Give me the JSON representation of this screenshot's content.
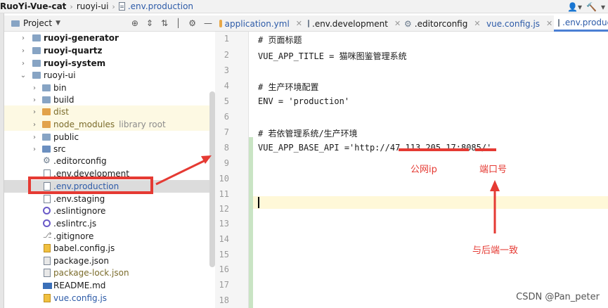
{
  "breadcrumb": {
    "project": "RuoYi-Vue-cat",
    "module": "ruoyi-ui",
    "file": ".env.production"
  },
  "project_panel": {
    "title": "Project"
  },
  "tree": [
    {
      "label": "ruoyi-generator",
      "bold": true
    },
    {
      "label": "ruoyi-quartz",
      "bold": true
    },
    {
      "label": "ruoyi-system",
      "bold": true
    },
    {
      "label": "ruoyi-ui"
    },
    {
      "label": "bin"
    },
    {
      "label": "build"
    },
    {
      "label": "dist"
    },
    {
      "label": "node_modules",
      "suffix": "library root"
    },
    {
      "label": "public"
    },
    {
      "label": "src"
    },
    {
      "label": ".editorconfig"
    },
    {
      "label": ".env.development"
    },
    {
      "label": ".env.production"
    },
    {
      "label": ".env.staging"
    },
    {
      "label": ".eslintignore"
    },
    {
      "label": ".eslintrc.js"
    },
    {
      "label": ".gitignore"
    },
    {
      "label": "babel.config.js"
    },
    {
      "label": "package.json"
    },
    {
      "label": "package-lock.json"
    },
    {
      "label": "README.md"
    },
    {
      "label": "vue.config.js"
    }
  ],
  "tabs": [
    {
      "label": "application.yml"
    },
    {
      "label": ".env.development"
    },
    {
      "label": ".editorconfig"
    },
    {
      "label": "vue.config.js"
    },
    {
      "label": ".env.production"
    }
  ],
  "editor": {
    "line_numbers": [
      "1",
      "2",
      "3",
      "4",
      "5",
      "6",
      "7",
      "8",
      "9",
      "10",
      "11",
      "12",
      "13",
      "14",
      "15",
      "16",
      "17",
      "18"
    ],
    "lines": [
      "# 页面标题",
      "VUE_APP_TITLE = 猫咪图鉴管理系统",
      "",
      "# 生产环境配置",
      "ENV = 'production'",
      "",
      "# 若依管理系统/生产环境",
      "VUE_APP_BASE_API ='http://47.113.205.17:8085/'"
    ]
  },
  "annotations": {
    "ip_label": "公网ip",
    "port_label": "端口号",
    "backend_label": "与后端一致",
    "accent_color": "#e53a33"
  },
  "watermark": "CSDN @Pan_peter"
}
